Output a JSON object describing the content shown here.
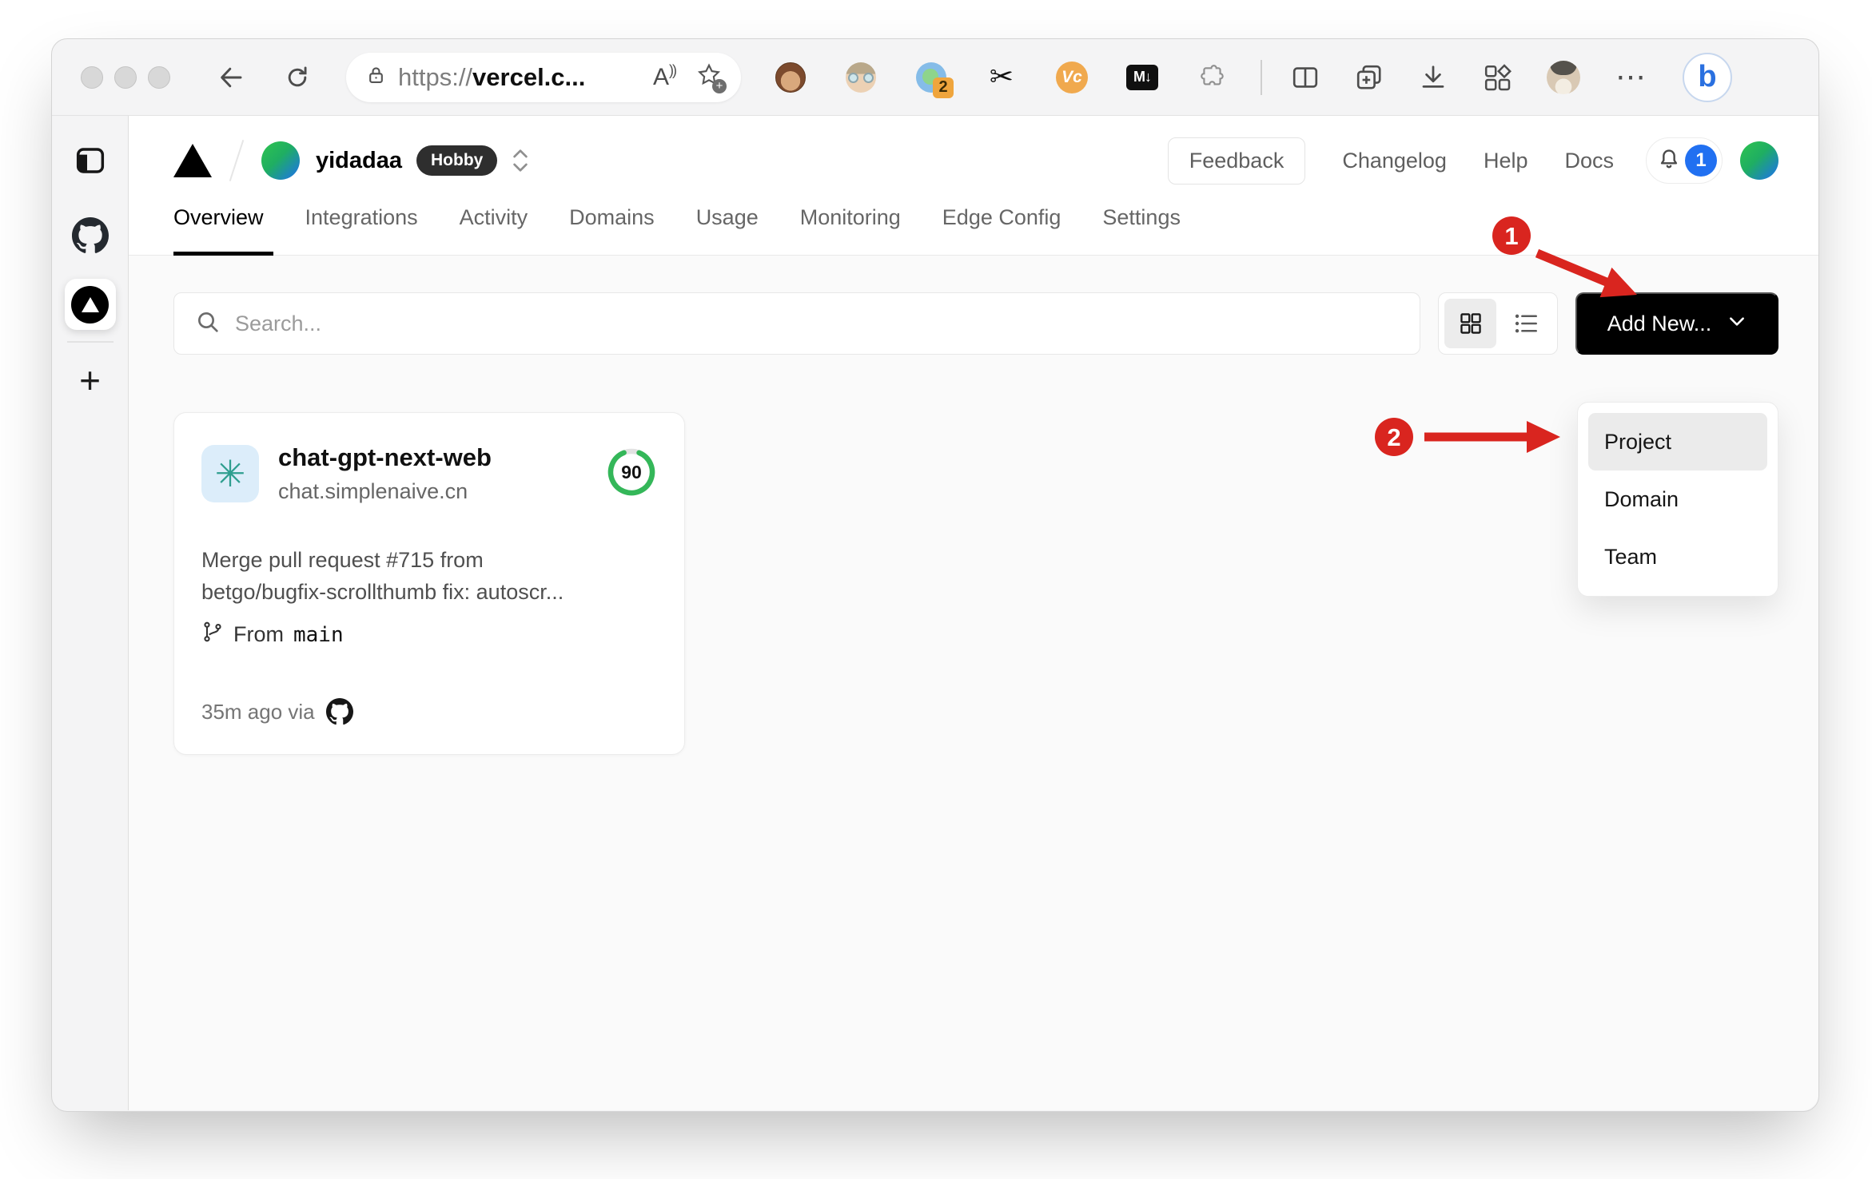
{
  "browser": {
    "url": {
      "scheme": "https://",
      "host": "vercel.c..."
    },
    "read_aloud_glyph": "A",
    "extensions": [
      {
        "name": "tampermonkey"
      },
      {
        "name": "user-face"
      },
      {
        "name": "status-circle",
        "badge": "2"
      },
      {
        "name": "scissors",
        "glyph": "✂"
      },
      {
        "name": "vc",
        "label": "Vc"
      },
      {
        "name": "markdown",
        "label": "M↓"
      },
      {
        "name": "puzzle"
      }
    ],
    "more_glyph": "⋯",
    "bing_glyph": "b"
  },
  "vercel": {
    "breadcrumb": {
      "team_name": "yidadaa",
      "plan_badge": "Hobby"
    },
    "header_links": {
      "feedback": "Feedback",
      "changelog": "Changelog",
      "help": "Help",
      "docs": "Docs",
      "notification_count": "1"
    },
    "tabs": {
      "items": [
        "Overview",
        "Integrations",
        "Activity",
        "Domains",
        "Usage",
        "Monitoring",
        "Edge Config",
        "Settings"
      ],
      "active": "Overview"
    },
    "controls": {
      "search_placeholder": "Search...",
      "add_new_label": "Add New..."
    },
    "dropdown": {
      "items": [
        "Project",
        "Domain",
        "Team"
      ],
      "highlighted": "Project"
    },
    "project_card": {
      "name": "chat-gpt-next-web",
      "domain": "chat.simplenaive.cn",
      "score": "90",
      "commit_line1": "Merge pull request #715 from",
      "commit_line2": "betgo/bugfix-scrollthumb fix: autoscr...",
      "branch_label": "From",
      "branch_name": "main",
      "deployed_meta": "35m ago via"
    }
  },
  "annotations": {
    "step1": "1",
    "step2": "2",
    "color": "#d9251f"
  },
  "colors": {
    "add_new_bg": "#000000",
    "notification_badge_blue": "#2170f1",
    "score_ring_green": "#34b759",
    "hobby_badge_bg": "#2e2e2e",
    "content_bg": "#fafafa",
    "annotation_red": "#d9251f",
    "extension_badge_orange": "#efa53d"
  }
}
